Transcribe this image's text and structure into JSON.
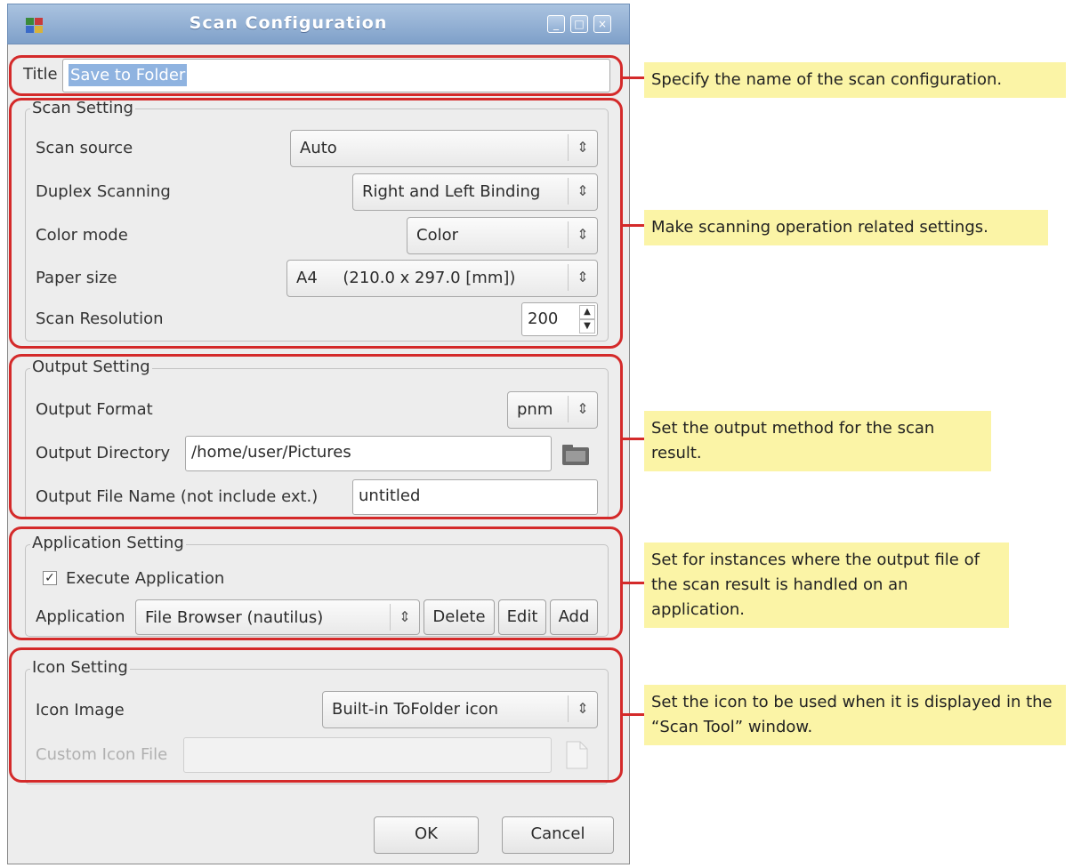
{
  "window": {
    "title": "Scan Configuration",
    "buttons": [
      "minimize",
      "maximize",
      "close"
    ]
  },
  "title_field": {
    "label": "Title",
    "value": "Save to Folder"
  },
  "scan_setting": {
    "group_title": "Scan Setting",
    "scan_source": {
      "label": "Scan source",
      "value": "Auto"
    },
    "duplex": {
      "label": "Duplex Scanning",
      "value": "Right and Left Binding"
    },
    "color_mode": {
      "label": "Color mode",
      "value": "Color"
    },
    "paper_size": {
      "label": "Paper size",
      "value": "A4     (210.0 x 297.0 [mm])"
    },
    "resolution": {
      "label": "Scan Resolution",
      "value": "200"
    }
  },
  "output_setting": {
    "group_title": "Output Setting",
    "format": {
      "label": "Output Format",
      "value": "pnm"
    },
    "directory": {
      "label": "Output Directory",
      "value": "/home/user/Pictures"
    },
    "file_name": {
      "label": "Output File Name (not include ext.)",
      "value": "untitled"
    }
  },
  "application_setting": {
    "group_title": "Application Setting",
    "execute": {
      "label": "Execute Application",
      "checked": true
    },
    "application": {
      "label": "Application",
      "value": "File Browser (nautilus)"
    },
    "delete_label": "Delete",
    "edit_label": "Edit",
    "add_label": "Add"
  },
  "icon_setting": {
    "group_title": "Icon Setting",
    "icon_image": {
      "label": "Icon Image",
      "value": "Built-in ToFolder icon"
    },
    "custom_icon_file": {
      "label": "Custom Icon File",
      "value": ""
    }
  },
  "footer": {
    "ok_label": "OK",
    "cancel_label": "Cancel"
  },
  "callouts": {
    "title": "Specify the name of the scan configuration.",
    "scan": "Make scanning operation related settings.",
    "output": "Set the output method for the scan result.",
    "application": "Set for instances where the output file of the scan result is handled on an application.",
    "icon": "Set the icon to be used when it is displayed in the “Scan Tool” window."
  },
  "colors": {
    "highlight": "#d42a2a",
    "callout_bg": "#fbf4a6",
    "titlebar": "#8fadd3",
    "selection": "#8fb3e0"
  }
}
